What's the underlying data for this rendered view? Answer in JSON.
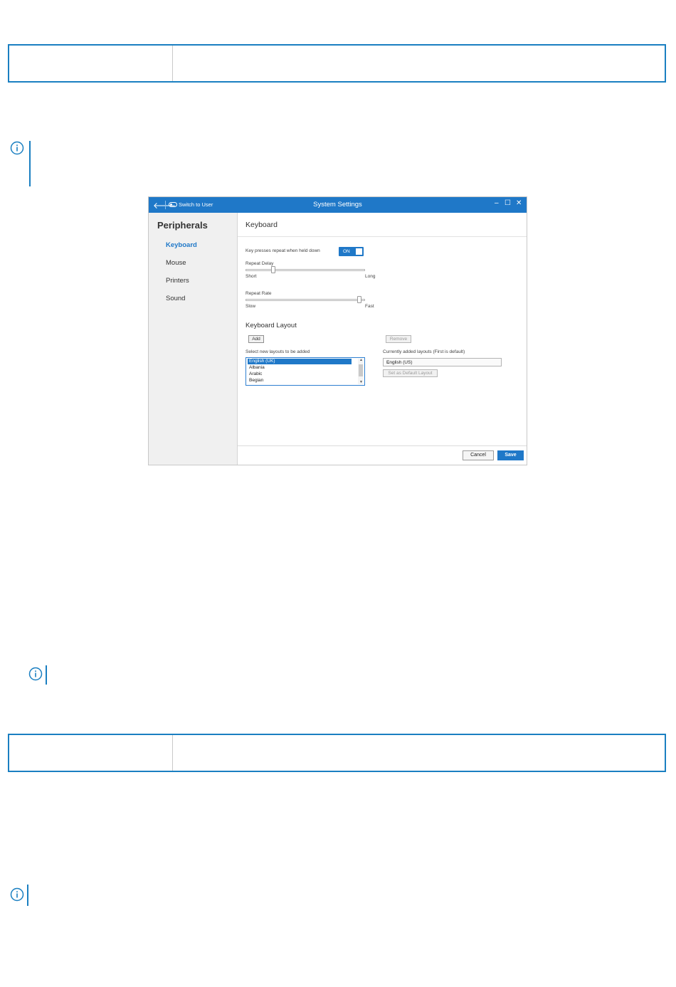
{
  "window": {
    "back_icon": "arrow-left-icon",
    "switch_label": "Switch to User",
    "title": "System Settings",
    "minimize_glyph": "–",
    "maximize_glyph": "☐",
    "close_glyph": "✕"
  },
  "sidebar": {
    "heading": "Peripherals",
    "items": [
      {
        "label": "Keyboard",
        "active": true
      },
      {
        "label": "Mouse",
        "active": false
      },
      {
        "label": "Printers",
        "active": false
      },
      {
        "label": "Sound",
        "active": false
      }
    ]
  },
  "keyboard": {
    "title": "Keyboard",
    "repeat_label": "Key presses repeat when held down",
    "repeat_toggle": "ON",
    "repeat_delay": {
      "label": "Repeat Delay",
      "min_label": "Short",
      "max_label": "Long",
      "value_fraction": 0.22
    },
    "repeat_rate": {
      "label": "Repeat Rate",
      "min_label": "Slow",
      "max_label": "Fast",
      "value_fraction": 0.97
    },
    "layout_section": "Keyboard Layout",
    "add_button": "Add",
    "remove_button": "Remove",
    "new_layouts_label": "Select new layouts to be added",
    "new_layouts": [
      "English (UK)",
      "Albania",
      "Arabic",
      "Begian"
    ],
    "current_layouts_label": "Currently added layouts (First is default)",
    "current_layout": "English (US)",
    "set_default_button": "Set as Default Layout",
    "cancel_button": "Cancel",
    "save_button": "Save"
  },
  "colors": {
    "accent": "#1f78c8",
    "border": "#1a7fc1"
  }
}
